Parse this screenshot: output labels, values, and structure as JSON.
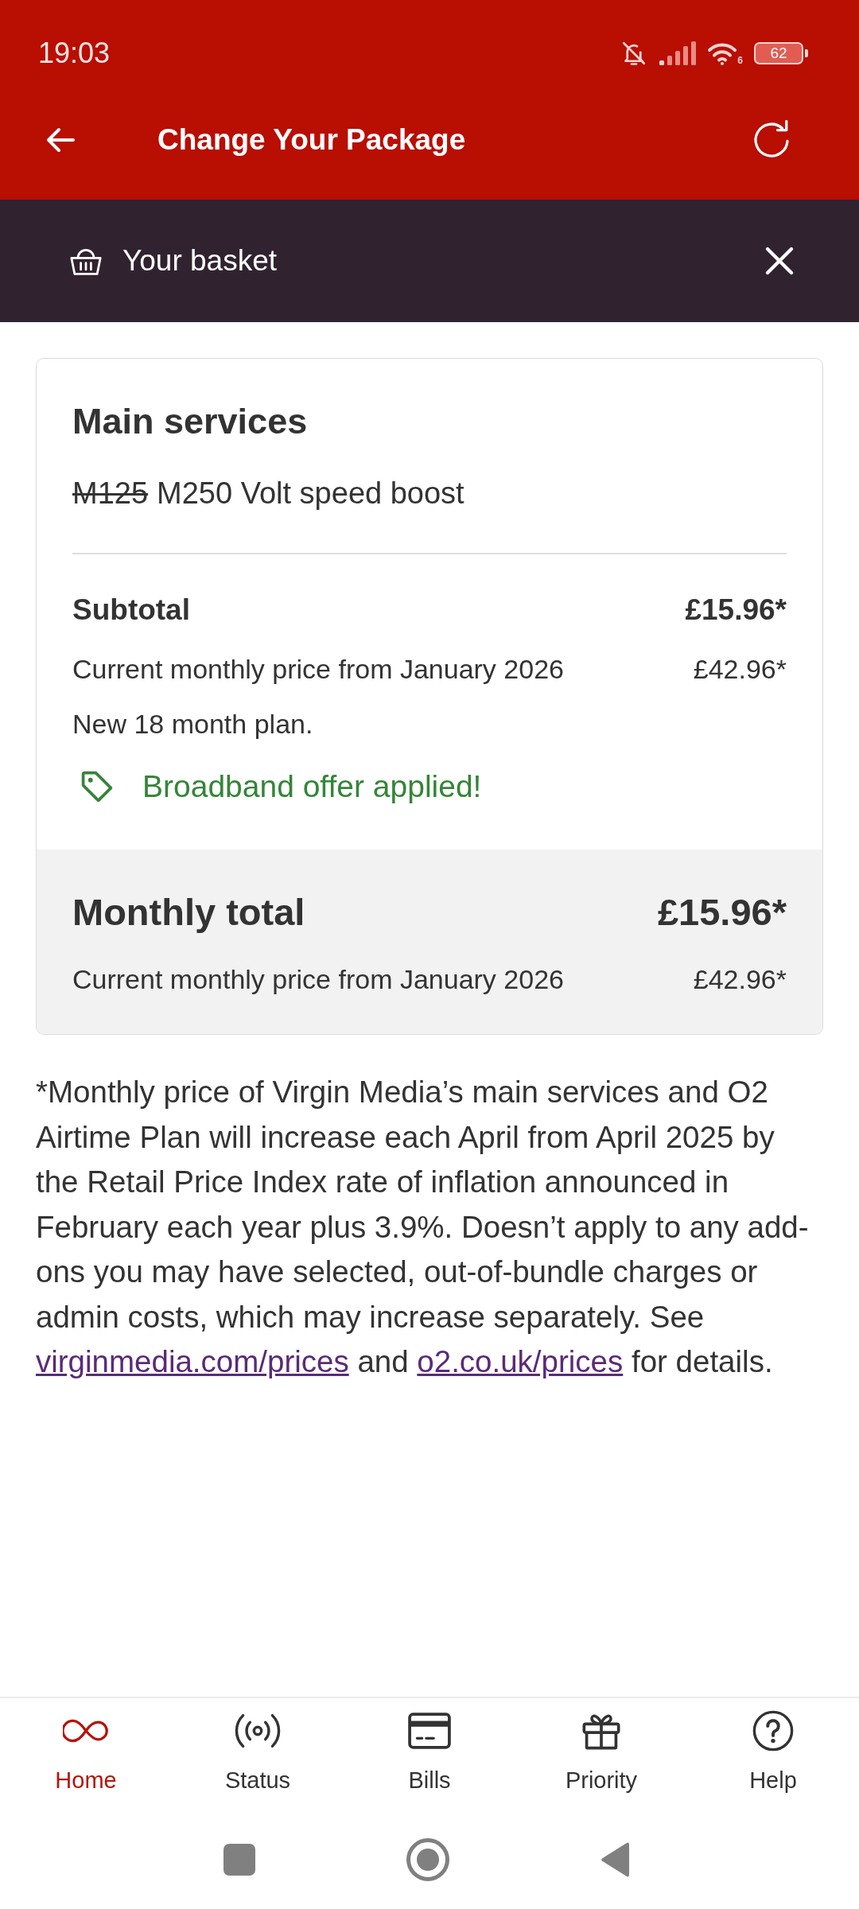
{
  "status_bar": {
    "time": "19:03",
    "wifi_label": "6",
    "battery": "62"
  },
  "header": {
    "title": "Change Your Package"
  },
  "basket_bar": {
    "title": "Your basket"
  },
  "main_services": {
    "title": "Main services",
    "previous_package": "M125",
    "new_package": "M250 Volt speed boost",
    "subtotal": {
      "label": "Subtotal",
      "price": "£15.96*"
    },
    "current_price": {
      "label": "Current monthly price from January 2026",
      "price": "£42.96*"
    },
    "plan_note": "New 18 month plan.",
    "offer": "Broadband offer applied!"
  },
  "monthly_total": {
    "label": "Monthly total",
    "price": "£15.96*",
    "current_price": {
      "label": "Current monthly price from January 2026",
      "price": "£42.96*"
    }
  },
  "footnote": [
    {
      "kind": "text",
      "text": "*Monthly price of Virgin Media’s main services and O2 Airtime Plan will increase each April from April 2025 by the Retail Price Index rate of inflation announced in February each year plus 3.9%. Doesn’t apply to any add-ons you may have selected, out-of-bundle charges or admin costs, which may increase separately. See "
    },
    {
      "kind": "link",
      "text": "virginmedia.com/prices"
    },
    {
      "kind": "text",
      "text": " and "
    },
    {
      "kind": "link",
      "text": "o2.co.uk/prices"
    },
    {
      "kind": "text",
      "text": " for details."
    }
  ],
  "bottom_nav": [
    {
      "label": "Home",
      "selected": true
    },
    {
      "label": "Status",
      "selected": false
    },
    {
      "label": "Bills",
      "selected": false
    },
    {
      "label": "Priority",
      "selected": false
    },
    {
      "label": "Help",
      "selected": false
    }
  ]
}
